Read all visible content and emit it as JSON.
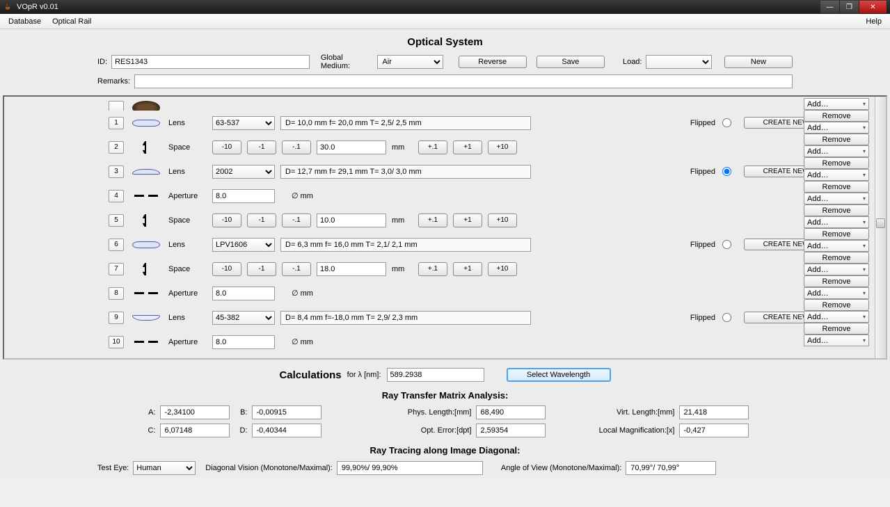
{
  "window": {
    "title": "VOpR v0.01"
  },
  "menu": {
    "database": "Database",
    "optical_rail": "Optical Rail",
    "help": "Help"
  },
  "header": {
    "title": "Optical System",
    "id_label": "ID:",
    "id_value": "RES1343",
    "medium_label": "Global Medium:",
    "medium_value": "Air",
    "reverse": "Reverse",
    "save": "Save",
    "load_label": "Load:",
    "new_btn": "New",
    "remarks_label": "Remarks:",
    "remarks_value": ""
  },
  "rail": {
    "create_lens": "CREATE NEW LENS",
    "flipped": "Flipped",
    "add": "Add…",
    "remove": "Remove",
    "step": {
      "m10": "-10",
      "m1": "-1",
      "m01": "-.1",
      "p01": "+.1",
      "p1": "+1",
      "p10": "+10"
    },
    "unit_mm": "mm",
    "unit_diam": "∅ mm",
    "kinds": {
      "lens": "Lens",
      "space": "Space",
      "aperture": "Aperture"
    },
    "rows": [
      {
        "idx": "1",
        "type": "lens",
        "sel": "63-537",
        "specs": "D= 10,0 mm  f= 20,0 mm  T=  2,5/  2,5 mm",
        "flipped": false
      },
      {
        "idx": "2",
        "type": "space",
        "val": "30.0"
      },
      {
        "idx": "3",
        "type": "lens",
        "sel": "2002",
        "specs": "D= 12,7 mm  f= 29,1 mm  T=  3,0/  3,0 mm",
        "flipped": true
      },
      {
        "idx": "4",
        "type": "aperture",
        "val": "8.0"
      },
      {
        "idx": "5",
        "type": "space",
        "val": "10.0"
      },
      {
        "idx": "6",
        "type": "lens",
        "sel": "LPV1606",
        "specs": "D=  6,3 mm  f= 16,0 mm  T=  2,1/  2,1 mm",
        "flipped": false
      },
      {
        "idx": "7",
        "type": "space",
        "val": "18.0"
      },
      {
        "idx": "8",
        "type": "aperture",
        "val": "8.0"
      },
      {
        "idx": "9",
        "type": "lens",
        "sel": "45-382",
        "specs": "D=  8,4 mm  f=-18,0 mm  T=  2,9/  2,3 mm",
        "flipped": false
      },
      {
        "idx": "10",
        "type": "aperture",
        "val": "8.0"
      }
    ]
  },
  "calc": {
    "title": "Calculations",
    "lambda_label": "for λ [nm]:",
    "lambda_value": "589.2938",
    "select_wavelength": "Select Wavelength",
    "matrix_title": "Ray Transfer Matrix Analysis:",
    "A_l": "A:",
    "A": "-2,34100",
    "B_l": "B:",
    "B": "-0,00915",
    "C_l": "C:",
    "C": "6,07148",
    "D_l": "D:",
    "D": "-0,40344",
    "phys_l": "Phys. Length:[mm]",
    "phys": "68,490",
    "virt_l": "Virt. Length:[mm]",
    "virt": "21,418",
    "opt_l": "Opt. Error:[dpt]",
    "opt": "2,59354",
    "mag_l": "Local Magnification:[x]",
    "mag": "-0,427",
    "trace_title": "Ray Tracing along Image Diagonal:",
    "eye_l": "Test Eye:",
    "eye": "Human",
    "diag_l": "Diagonal Vision (Monotone/Maximal):",
    "diag": "99,90%/ 99,90%",
    "aov_l": "Angle of View (Monotone/Maximal):",
    "aov": "70,99°/ 70,99°"
  }
}
